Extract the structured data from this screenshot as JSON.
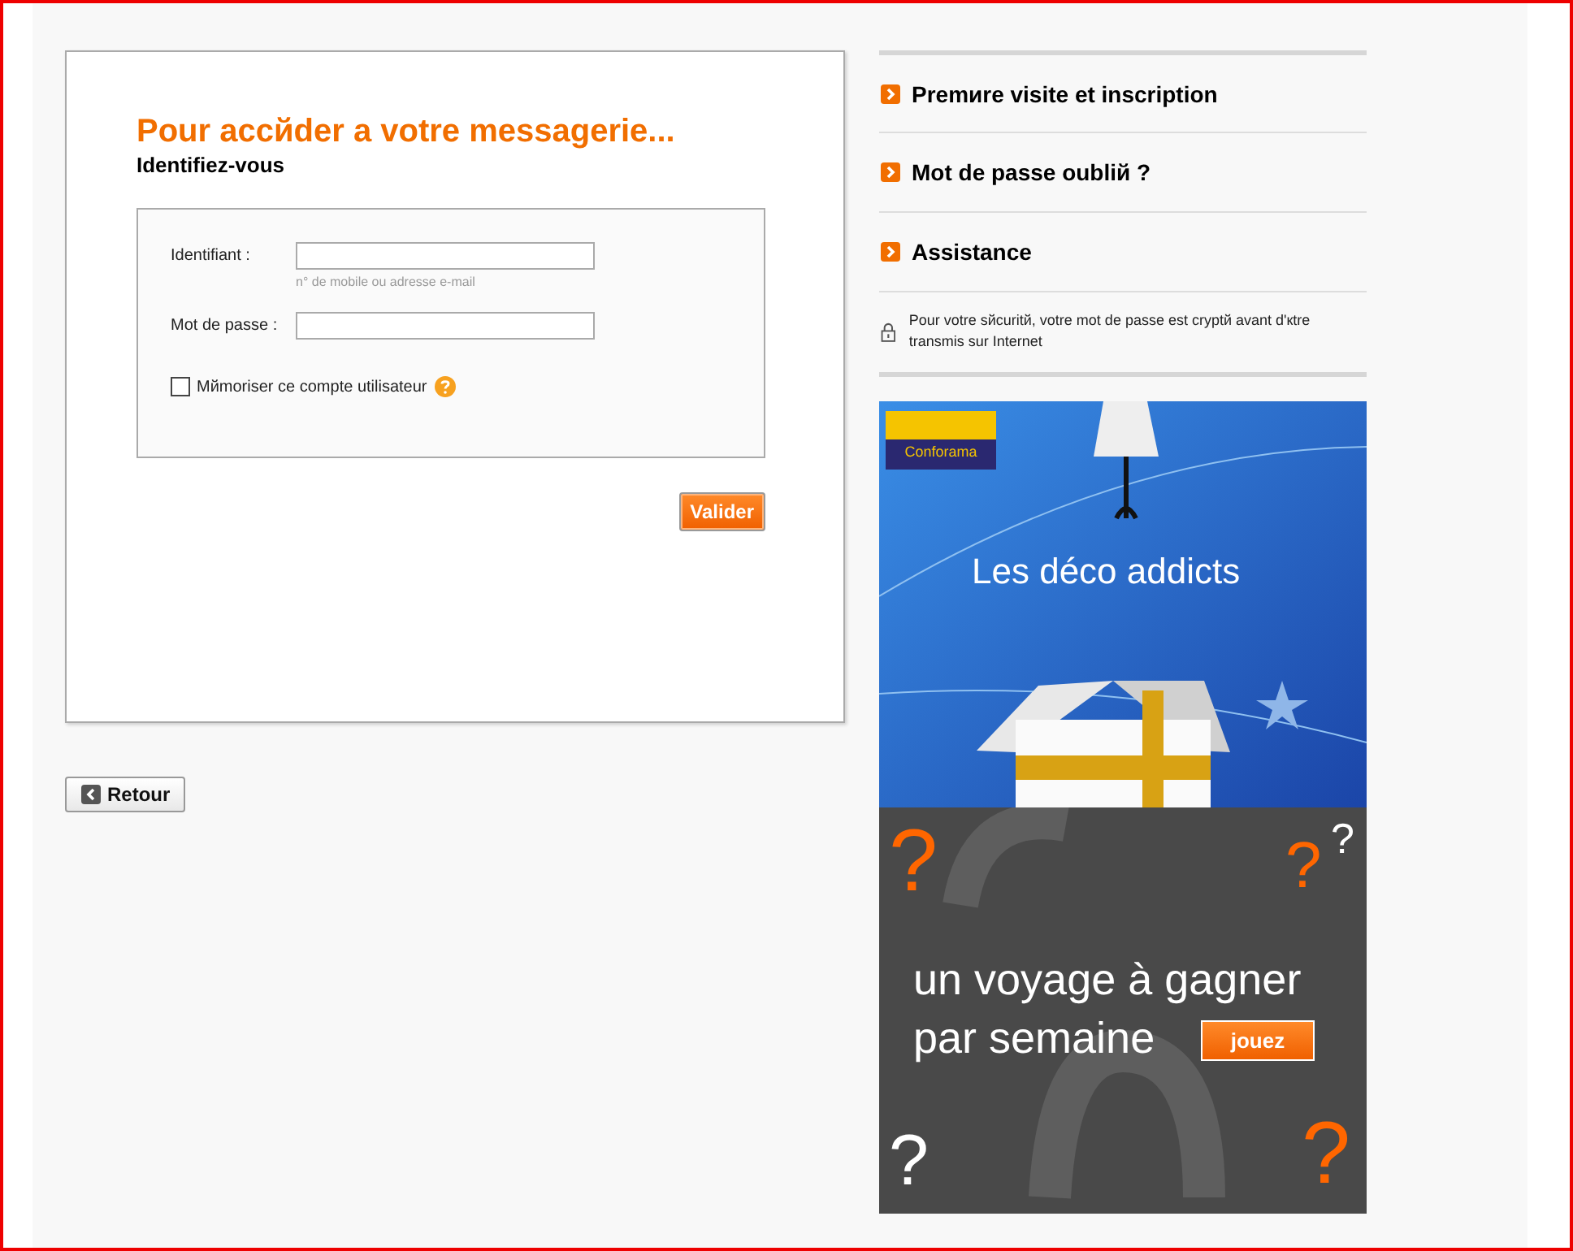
{
  "login": {
    "title": "Pour accйder a votre messagerie...",
    "subtitle": "Identifiez-vous",
    "fields": [
      {
        "label": "Identifiant :",
        "hint": "n° de mobile ou adresse e-mail"
      },
      {
        "label": "Mot de passe :"
      }
    ],
    "remember": {
      "label": "Mйmoriser ce compte utilisateur",
      "checked": false
    },
    "submit": "Valider"
  },
  "back_button": "Retour",
  "links": [
    "Premиre visite et inscription",
    "Mot de passe oubliй ?",
    "Assistance"
  ],
  "security_note": "Pour votre sйcuritй, votre mot de passe est cryptй avant d'кtre transmis sur Internet",
  "ad_top": {
    "brand": "Conforama",
    "headline": "Les déco addicts"
  },
  "ad_bottom": {
    "headline_lines": [
      "un voyage à gagner",
      "par semaine"
    ],
    "button": "jouez",
    "marks": [
      {
        "text": "?",
        "color": "#ff6600"
      },
      {
        "text": "?",
        "color": "#ff6600"
      },
      {
        "text": "?",
        "color": "#ffffff"
      },
      {
        "text": "?",
        "color": "#ffffff"
      },
      {
        "text": "?",
        "color": "#ff6600"
      }
    ]
  }
}
